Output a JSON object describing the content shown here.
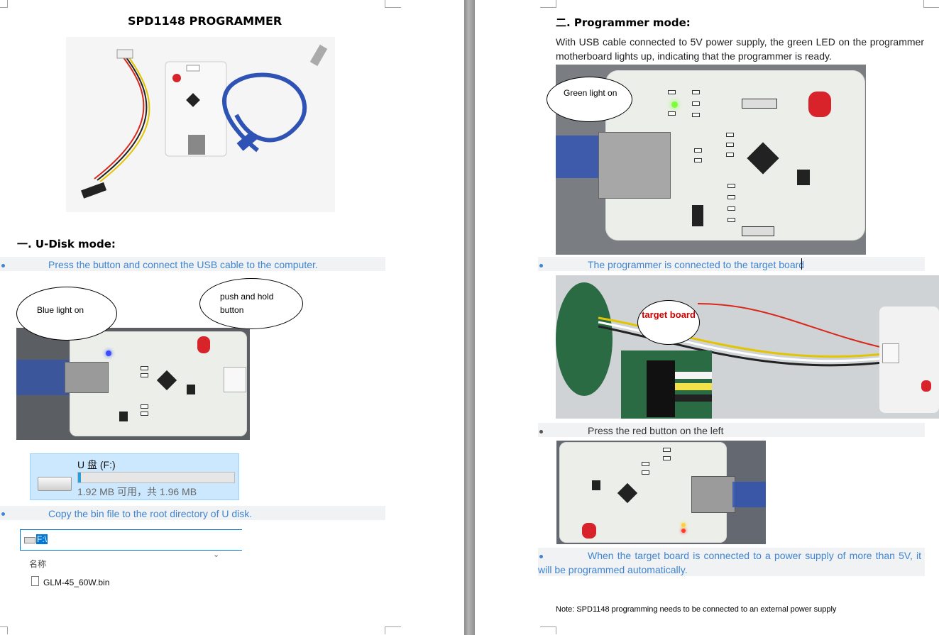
{
  "left_page": {
    "title": "SPD1148 PROGRAMMER",
    "section1_heading": "一. U-Disk mode:",
    "bullet1": "Press the button and connect the USB cable to the computer.",
    "callout_blue": "Blue light on",
    "callout_push": "push   and   hold button",
    "drive": {
      "name": "U 盘 (F:)",
      "usage_fraction": 0.02,
      "caption": "1.92 MB 可用，共 1.96 MB"
    },
    "bullet2": "Copy the bin file to the root directory of U disk.",
    "explorer": {
      "path": "F:\\",
      "column_header": "名称",
      "file_name": "GLM-45_60W.bin"
    }
  },
  "right_page": {
    "section2_heading": "二. Programmer mode:",
    "intro": "With USB cable connected to 5V power supply, the green LED on the programmer motherboard lights up, indicating that the programmer is ready.",
    "callout_green": "Green   light on",
    "bullet3": "The programmer is connected to the target board",
    "callout_target": "target board",
    "bullet4": "Press the red button on the left",
    "bullet5": "When the target board is connected to a power supply of more than 5V, it will be programmed automatically.",
    "note": "Note: SPD1148 programming needs to be connected to an external power supply"
  },
  "colors": {
    "bullet_blue": "#3f85d0",
    "callout_red": "#d40000",
    "led_green": "#7cff3a",
    "led_blue": "#3b4dff",
    "button_red": "#d8232a",
    "usb_blue": "#2f53b5"
  }
}
